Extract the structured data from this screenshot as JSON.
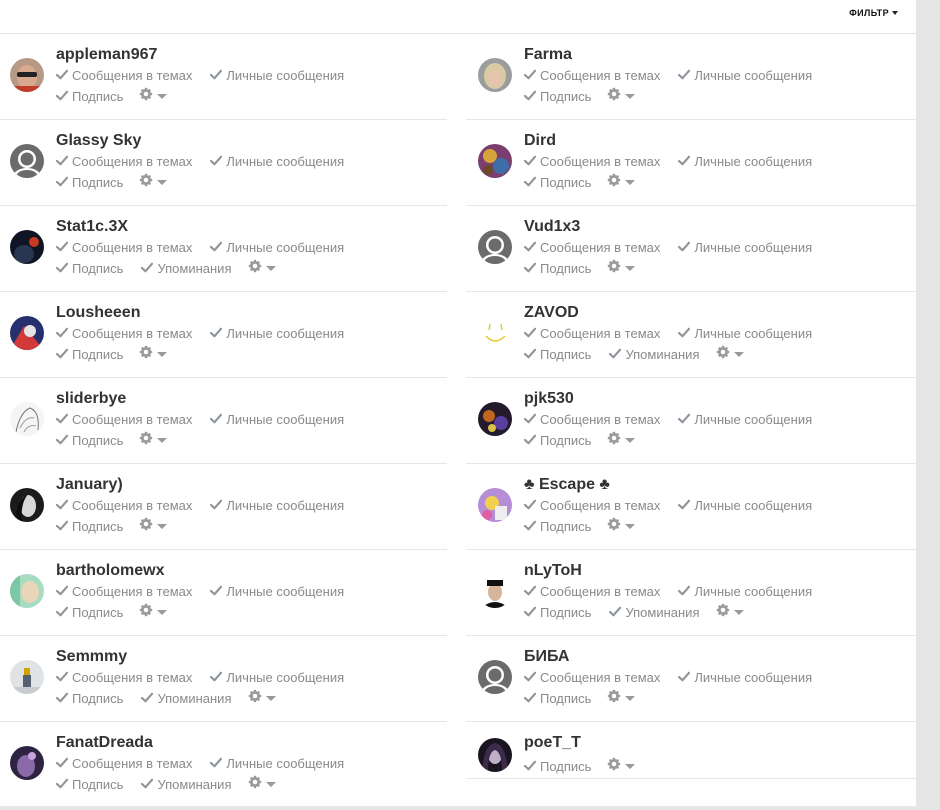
{
  "header": {
    "filter_label": "ФИЛЬТР"
  },
  "labels": {
    "topics": "Сообщения в темах",
    "pm": "Личные сообщения",
    "sub": "Подпись",
    "mentions": "Упоминания"
  },
  "left": [
    {
      "name": "appleman967",
      "mentions": false,
      "avatar": "photo-sunglasses"
    },
    {
      "name": "Glassy Sky",
      "mentions": false,
      "avatar": "default"
    },
    {
      "name": "Stat1c.3X",
      "mentions": true,
      "avatar": "photo-dark-red"
    },
    {
      "name": "Lousheeen",
      "mentions": false,
      "avatar": "photo-captain"
    },
    {
      "name": "sliderbye",
      "mentions": false,
      "avatar": "sketch"
    },
    {
      "name": "January)",
      "mentions": false,
      "avatar": "photo-bw-portrait"
    },
    {
      "name": "bartholomewx",
      "mentions": false,
      "avatar": "photo-green"
    },
    {
      "name": "Semmmy",
      "mentions": true,
      "avatar": "photo-standing-figure"
    },
    {
      "name": "FanatDreada",
      "mentions": true,
      "avatar": "photo-purple"
    }
  ],
  "right": [
    {
      "name": "Farma",
      "mentions": false,
      "avatar": "photo-blonde"
    },
    {
      "name": "Dird",
      "mentions": false,
      "avatar": "photo-colorful"
    },
    {
      "name": "Vud1x3",
      "mentions": false,
      "avatar": "default"
    },
    {
      "name": "ZAVOD",
      "mentions": true,
      "avatar": "smiley-yellow"
    },
    {
      "name": "pjk530",
      "mentions": false,
      "avatar": "photo-dark-orange"
    },
    {
      "name": "♣ Escape ♣",
      "mentions": false,
      "avatar": "photo-cartoon"
    },
    {
      "name": "nLyToH",
      "mentions": true,
      "avatar": "photo-man-hat"
    },
    {
      "name": "БИБА",
      "mentions": false,
      "avatar": "default"
    },
    {
      "name": "poeT_T",
      "mentions": false,
      "avatar": "photo-dark-girl",
      "only_signature": true
    }
  ]
}
